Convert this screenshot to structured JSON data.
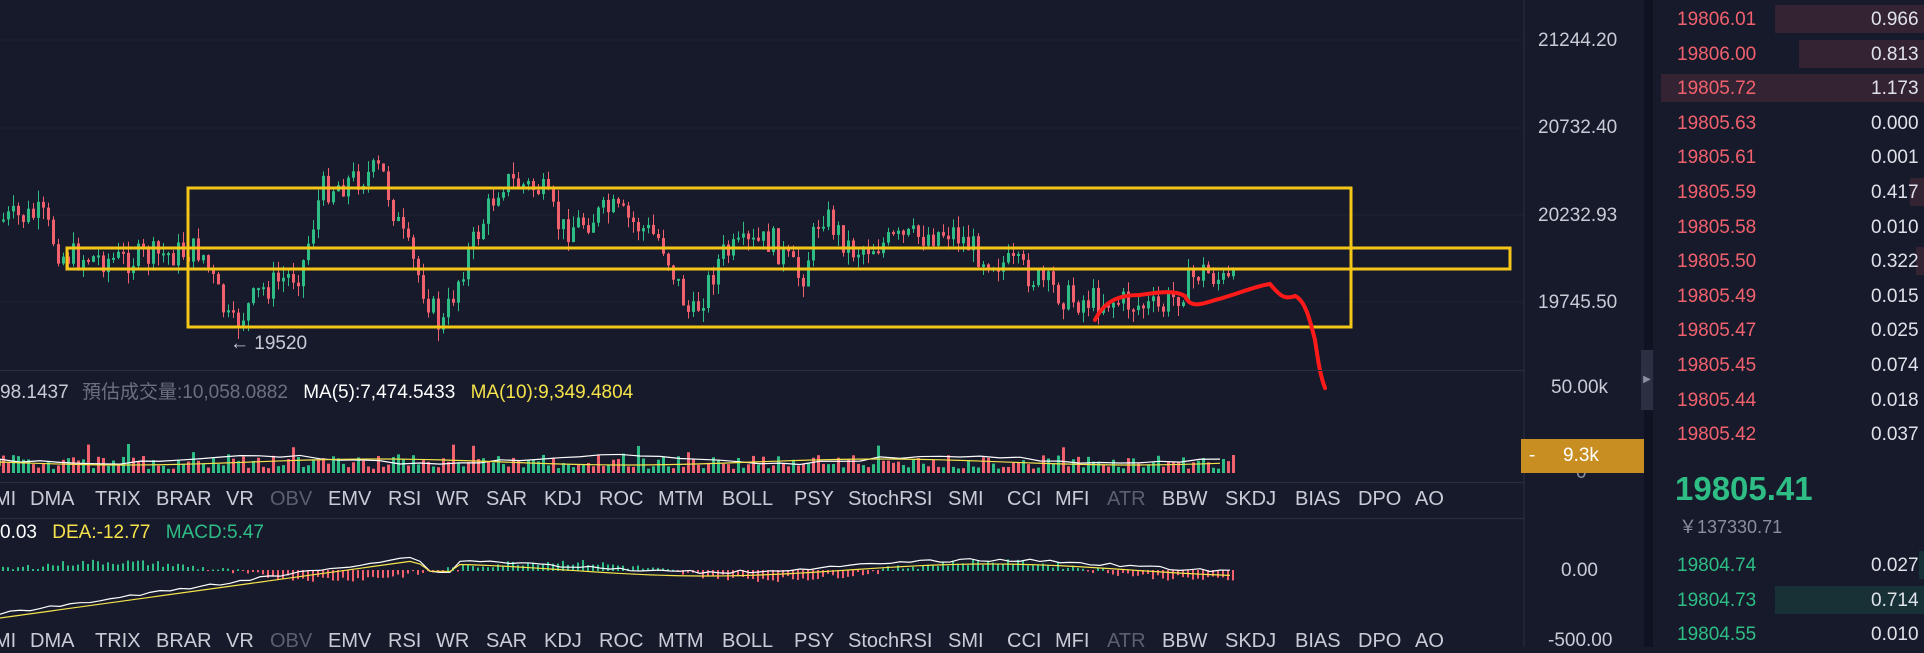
{
  "price_axis": {
    "labels": [
      "21244.20",
      "20732.40",
      "20232.93",
      "19745.50"
    ]
  },
  "annotation_low": "← 19520",
  "volume_legend": {
    "partial_vol": "98.1437",
    "est_label": "預估成交量",
    "est_value": ":10,058.0882",
    "ma5": "MA(5):7,474.5433",
    "ma10": "MA(10):9,349.4804"
  },
  "volume_axis": {
    "top": "50.00k",
    "zero": "0",
    "badge": "9.3k",
    "badge_dash": "-"
  },
  "indicator_tabs": [
    {
      "label": "MI",
      "dim": false
    },
    {
      "label": "DMA",
      "dim": false
    },
    {
      "label": "TRIX",
      "dim": false
    },
    {
      "label": "BRAR",
      "dim": false
    },
    {
      "label": "VR",
      "dim": false
    },
    {
      "label": "OBV",
      "dim": true
    },
    {
      "label": "EMV",
      "dim": false
    },
    {
      "label": "RSI",
      "dim": false
    },
    {
      "label": "WR",
      "dim": false
    },
    {
      "label": "SAR",
      "dim": false
    },
    {
      "label": "KDJ",
      "dim": false
    },
    {
      "label": "ROC",
      "dim": false
    },
    {
      "label": "MTM",
      "dim": false
    },
    {
      "label": "BOLL",
      "dim": false
    },
    {
      "label": "PSY",
      "dim": false
    },
    {
      "label": "StochRSI",
      "dim": false
    },
    {
      "label": "SMI",
      "dim": false
    },
    {
      "label": "CCI",
      "dim": false
    },
    {
      "label": "MFI",
      "dim": false
    },
    {
      "label": "ATR",
      "dim": true
    },
    {
      "label": "BBW",
      "dim": false
    },
    {
      "label": "SKDJ",
      "dim": false
    },
    {
      "label": "BIAS",
      "dim": false
    },
    {
      "label": "DPO",
      "dim": false
    },
    {
      "label": "AO",
      "dim": false
    }
  ],
  "macd_legend": {
    "dif": "0.03",
    "dea": "DEA:-12.77",
    "macd": "MACD:5.47"
  },
  "macd_axis": {
    "zero": "0.00",
    "neg": "-500.00"
  },
  "orderbook": {
    "asks": [
      {
        "price": "19806.01",
        "qty": "0.966",
        "depth": 0.55
      },
      {
        "price": "19806.00",
        "qty": "0.813",
        "depth": 0.46
      },
      {
        "price": "19805.72",
        "qty": "1.173",
        "depth": 0.97
      },
      {
        "price": "19805.63",
        "qty": "0.000",
        "depth": 0.0
      },
      {
        "price": "19805.61",
        "qty": "0.001",
        "depth": 0.0
      },
      {
        "price": "19805.59",
        "qty": "0.417",
        "depth": 0.05
      },
      {
        "price": "19805.58",
        "qty": "0.010",
        "depth": 0.0
      },
      {
        "price": "19805.50",
        "qty": "0.322",
        "depth": 0.03
      },
      {
        "price": "19805.49",
        "qty": "0.015",
        "depth": 0.0
      },
      {
        "price": "19805.47",
        "qty": "0.025",
        "depth": 0.0
      },
      {
        "price": "19805.45",
        "qty": "0.074",
        "depth": 0.0
      },
      {
        "price": "19805.44",
        "qty": "0.018",
        "depth": 0.0
      },
      {
        "price": "19805.42",
        "qty": "0.037",
        "depth": 0.0
      }
    ],
    "last_price": "19805.41",
    "last_fiat": "￥137330.71",
    "bids": [
      {
        "price": "19804.74",
        "qty": "0.027",
        "depth": 0.02
      },
      {
        "price": "19804.73",
        "qty": "0.714",
        "depth": 0.55
      },
      {
        "price": "19804.55",
        "qty": "0.010",
        "depth": 0.0
      }
    ]
  },
  "colors": {
    "background": "#161a2b",
    "up": "#2ebd85",
    "down": "#f0616d",
    "box_highlight": "#f5c518",
    "drawing": "#ff1a1a",
    "ma10": "#f5e24a",
    "badge": "#c88e22"
  }
}
